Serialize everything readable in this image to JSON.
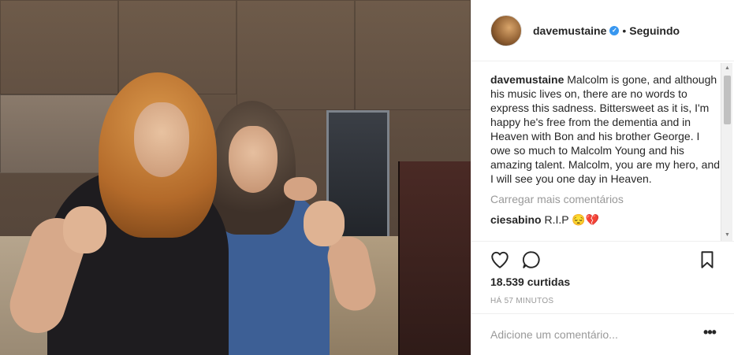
{
  "post": {
    "username": "davemustaine",
    "follow_status": "Seguindo",
    "separator": "•",
    "verified_icon": "verified-badge-icon",
    "caption_user": "davemustaine",
    "caption_text": "Malcolm is gone, and although his music lives on, there are no words to express this sadness. Bittersweet as it is, I'm happy he's free from the dementia and in Heaven with Bon and his brother George. I owe so much to Malcolm Young and his amazing talent. Malcolm, you are my hero, and I will see you one day in Heaven.",
    "load_more": "Carregar mais comentários",
    "comments": [
      {
        "user": "ciesabino",
        "text": "R.I.P 😔💔"
      }
    ],
    "likes": "18.539 curtidas",
    "timestamp": "HÁ 57 MINUTOS",
    "add_comment_placeholder": "Adicione um comentário...",
    "more_options": "•••"
  },
  "colors": {
    "accent_verified": "#3897f0",
    "muted_text": "#999999",
    "primary_text": "#262626",
    "divider": "#efefef"
  }
}
